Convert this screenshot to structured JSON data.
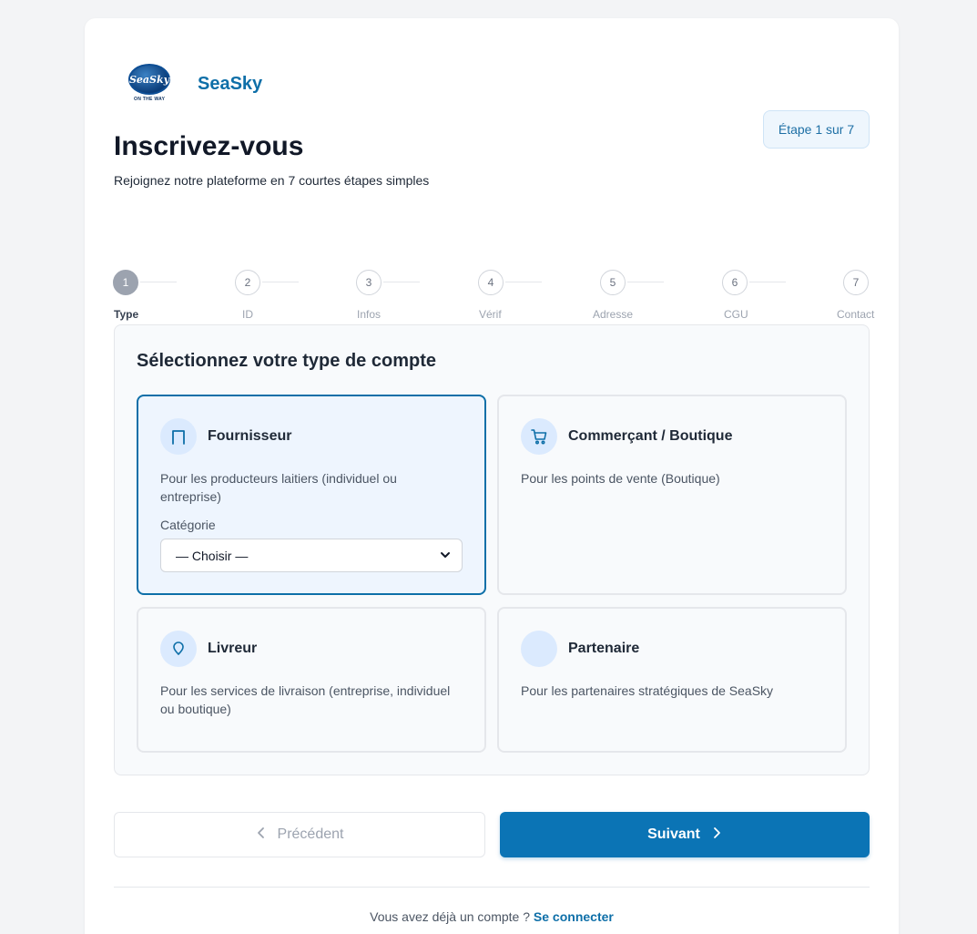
{
  "brand": {
    "name": "SeaSky",
    "logo_text": "SeaSky",
    "logo_tagline": "ON THE WAY"
  },
  "step_badge": "Étape 1 sur 7",
  "header": {
    "title": "Inscrivez-vous",
    "subtitle": "Rejoignez notre plateforme en 7 courtes étapes simples"
  },
  "stepper": {
    "current": 1,
    "steps": [
      {
        "number": "1",
        "label": "Type"
      },
      {
        "number": "2",
        "label": "ID"
      },
      {
        "number": "3",
        "label": "Infos"
      },
      {
        "number": "4",
        "label": "Vérif"
      },
      {
        "number": "5",
        "label": "Adresse"
      },
      {
        "number": "6",
        "label": "CGU"
      },
      {
        "number": "7",
        "label": "Contact"
      }
    ]
  },
  "account_type": {
    "heading": "Sélectionnez votre type de compte",
    "options": [
      {
        "title": "Fournisseur",
        "description": "Pour les producteurs laitiers (individuel ou entreprise)",
        "icon": "magnet-icon",
        "selected": true
      },
      {
        "title": "Commerçant / Boutique",
        "description": "Pour les points de vente (Boutique)",
        "icon": "cart-icon",
        "selected": false
      },
      {
        "title": "Livreur",
        "description": "Pour les services de livraison (entreprise, individuel ou boutique)",
        "icon": "location-pin-icon",
        "selected": false
      },
      {
        "title": "Partenaire",
        "description": "Pour les partenaires stratégiques de SeaSky",
        "icon": "",
        "selected": false
      }
    ],
    "category_label": "Catégorie",
    "category_value": "— Choisir —"
  },
  "navigation": {
    "prev_label": "Précédent",
    "next_label": "Suivant"
  },
  "footer": {
    "text": "Vous avez déjà un compte ?",
    "link": "Se connecter"
  },
  "colors": {
    "primary": "#0b74b5",
    "brand_text": "#0e6fa8",
    "selected_bg": "#eef5fe",
    "icon_bg": "#dbeafe"
  }
}
